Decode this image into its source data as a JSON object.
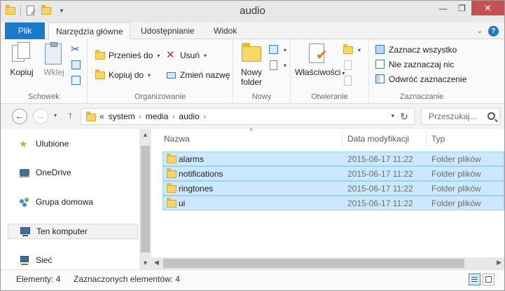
{
  "window": {
    "title": "audio"
  },
  "ribbon_tabs": {
    "file": "Plik",
    "home": "Narzędzia główne",
    "share": "Udostępnianie",
    "view": "Widok"
  },
  "ribbon": {
    "clipboard": {
      "label": "Schowek",
      "copy": "Kopiuj",
      "paste": "Wklej"
    },
    "organize": {
      "label": "Organizowanie",
      "move_to": "Przenieś do",
      "copy_to": "Kopiuj do",
      "delete": "Usuń",
      "rename": "Zmień nazwę"
    },
    "new": {
      "label": "Nowy",
      "new_folder_line1": "Nowy",
      "new_folder_line2": "folder"
    },
    "open": {
      "label": "Otwieranie",
      "properties": "Właściwości"
    },
    "select": {
      "label": "Zaznaczanie",
      "select_all": "Zaznacz wszystko",
      "select_none": "Nie zaznaczaj nic",
      "invert": "Odwróć zaznaczenie"
    }
  },
  "address": {
    "overflow": "«",
    "crumbs": [
      "system",
      "media",
      "audio"
    ],
    "search_placeholder": "Przeszukaj..."
  },
  "nav_pane": {
    "items": [
      {
        "label": "Ulubione",
        "icon": "star-icon"
      },
      {
        "label": "OneDrive",
        "icon": "cloud-icon"
      },
      {
        "label": "Grupa domowa",
        "icon": "homegroup-icon"
      },
      {
        "label": "Ten komputer",
        "icon": "computer-icon"
      },
      {
        "label": "Sieć",
        "icon": "network-icon"
      }
    ]
  },
  "columns": {
    "name": "Nazwa",
    "date": "Data modyfikacji",
    "type": "Typ"
  },
  "files": [
    {
      "name": "alarms",
      "date": "2015-06-17 11:22",
      "type": "Folder plików"
    },
    {
      "name": "notifications",
      "date": "2015-06-17 11:22",
      "type": "Folder plików"
    },
    {
      "name": "ringtones",
      "date": "2015-06-17 11:22",
      "type": "Folder plików"
    },
    {
      "name": "ui",
      "date": "2015-06-17 11:22",
      "type": "Folder plików"
    }
  ],
  "status": {
    "count": "Elementy: 4",
    "selected": "Zaznaczonych elementów: 4"
  },
  "colors": {
    "accent": "#1979ca",
    "selection_bg": "#cce8ff",
    "selection_border": "#99d1ff",
    "close_button": "#c75050"
  }
}
